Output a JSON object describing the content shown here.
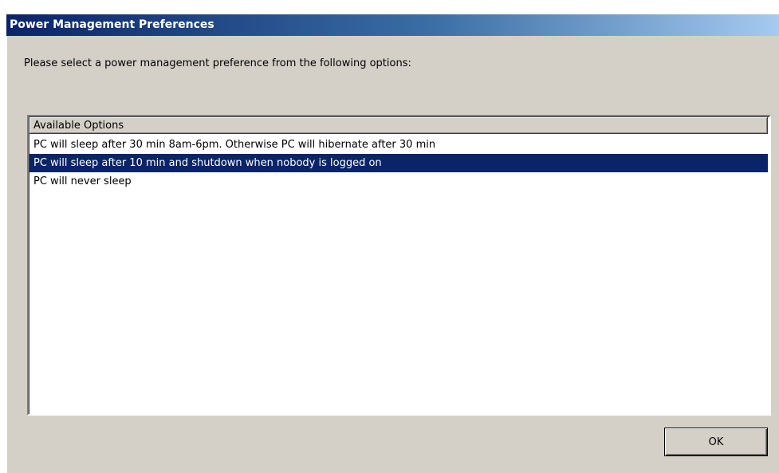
{
  "window": {
    "title": "Power Management Preferences"
  },
  "prompt": "Please select a power management preference from the following options:",
  "list": {
    "column_header": "Available Options",
    "items": [
      {
        "label": "PC will sleep after 30 min 8am-6pm. Otherwise PC will hibernate after 30 min",
        "selected": false
      },
      {
        "label": "PC will sleep after 10 min and shutdown when nobody is logged on",
        "selected": true
      },
      {
        "label": "PC will never sleep",
        "selected": false
      }
    ]
  },
  "buttons": {
    "ok_label": "OK"
  },
  "colors": {
    "title_bar_start": "#0a246a",
    "title_bar_end": "#a6caf0",
    "dialog_background": "#d4d0c8",
    "selection": "#0a246a"
  }
}
